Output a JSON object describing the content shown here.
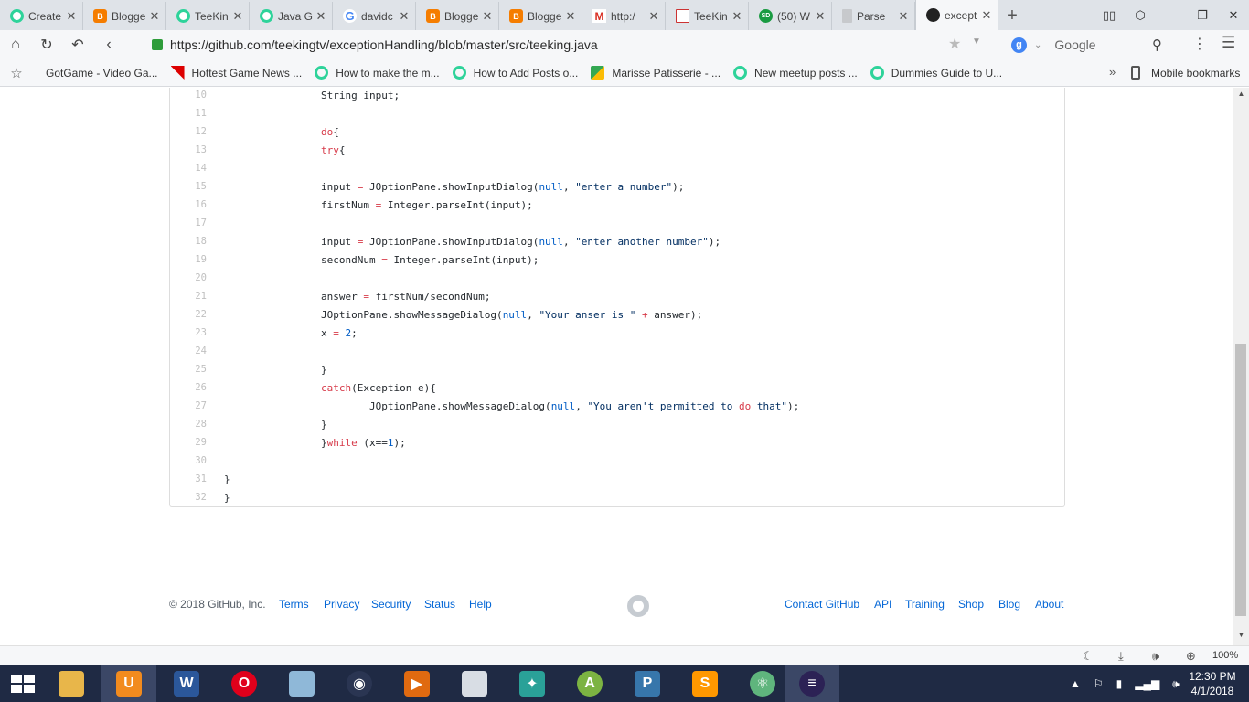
{
  "tabs": [
    {
      "label": "Create",
      "favicon": "green-circle-icon"
    },
    {
      "label": "Blogge",
      "favicon": "blogger-icon"
    },
    {
      "label": "TeeKin",
      "favicon": "green-circle-icon"
    },
    {
      "label": "Java G",
      "favicon": "green-circle-icon"
    },
    {
      "label": "davidc",
      "favicon": "google-icon"
    },
    {
      "label": "Blogge",
      "favicon": "blogger-icon"
    },
    {
      "label": "Blogge",
      "favicon": "blogger-icon"
    },
    {
      "label": "http:/",
      "favicon": "gmail-icon"
    },
    {
      "label": "TeeKin",
      "favicon": "chart-icon"
    },
    {
      "label": "(50) W",
      "favicon": "sd-icon"
    },
    {
      "label": "Parse",
      "favicon": "document-icon"
    },
    {
      "label": "except",
      "favicon": "github-icon",
      "active": true
    }
  ],
  "address": {
    "url": "https://github.com/teekingtv/exceptionHandling/blob/master/src/teeking.java",
    "search_engine": "Google"
  },
  "bookmarks": {
    "items": [
      {
        "label": "GotGame - Video Ga..."
      },
      {
        "label": "Hottest Game News ..."
      },
      {
        "label": "How to make the m..."
      },
      {
        "label": "How to Add Posts o..."
      },
      {
        "label": "Marisse Patisserie - ..."
      },
      {
        "label": "New meetup posts ..."
      },
      {
        "label": "Dummies Guide to U..."
      }
    ],
    "more": "»",
    "mobile": "Mobile bookmarks"
  },
  "code": {
    "lines": [
      {
        "n": "10",
        "text": "String input;"
      },
      {
        "n": "11",
        "text": ""
      },
      {
        "n": "12",
        "text": "do{"
      },
      {
        "n": "13",
        "text": "try{"
      },
      {
        "n": "14",
        "text": ""
      },
      {
        "n": "15",
        "text": "input = JOptionPane.showInputDialog(null, \"enter a number\");"
      },
      {
        "n": "16",
        "text": "firstNum = Integer.parseInt(input);"
      },
      {
        "n": "17",
        "text": ""
      },
      {
        "n": "18",
        "text": "input = JOptionPane.showInputDialog(null, \"enter another number\");"
      },
      {
        "n": "19",
        "text": "secondNum = Integer.parseInt(input);"
      },
      {
        "n": "20",
        "text": ""
      },
      {
        "n": "21",
        "text": "answer = firstNum/secondNum;"
      },
      {
        "n": "22",
        "text": "JOptionPane.showMessageDialog(null, \"Your anser is \" + answer);"
      },
      {
        "n": "23",
        "text": "x = 2;"
      },
      {
        "n": "24",
        "text": ""
      },
      {
        "n": "25",
        "text": "}"
      },
      {
        "n": "26",
        "text": "catch(Exception e){"
      },
      {
        "n": "27",
        "text": "JOptionPane.showMessageDialog(null, \"You aren't permitted to do that\");"
      },
      {
        "n": "28",
        "text": "}"
      },
      {
        "n": "29",
        "text": "}while (x==1);"
      },
      {
        "n": "30",
        "text": ""
      },
      {
        "n": "31",
        "text": "}"
      },
      {
        "n": "32",
        "text": "}"
      }
    ]
  },
  "footer": {
    "copyright": "© 2018 GitHub, Inc.",
    "left_links": [
      "Terms",
      "Privacy",
      "Security",
      "Status",
      "Help"
    ],
    "right_links": [
      "Contact GitHub",
      "API",
      "Training",
      "Shop",
      "Blog",
      "About"
    ]
  },
  "statusbar": {
    "zoom": "100%"
  },
  "taskbar": {
    "clock_time": "12:30 PM",
    "clock_date": "4/1/2018"
  },
  "colors": {
    "link": "#0366d6",
    "keyword": "#d73a49",
    "constant": "#005cc5",
    "taskbar": "#1f2a44"
  }
}
